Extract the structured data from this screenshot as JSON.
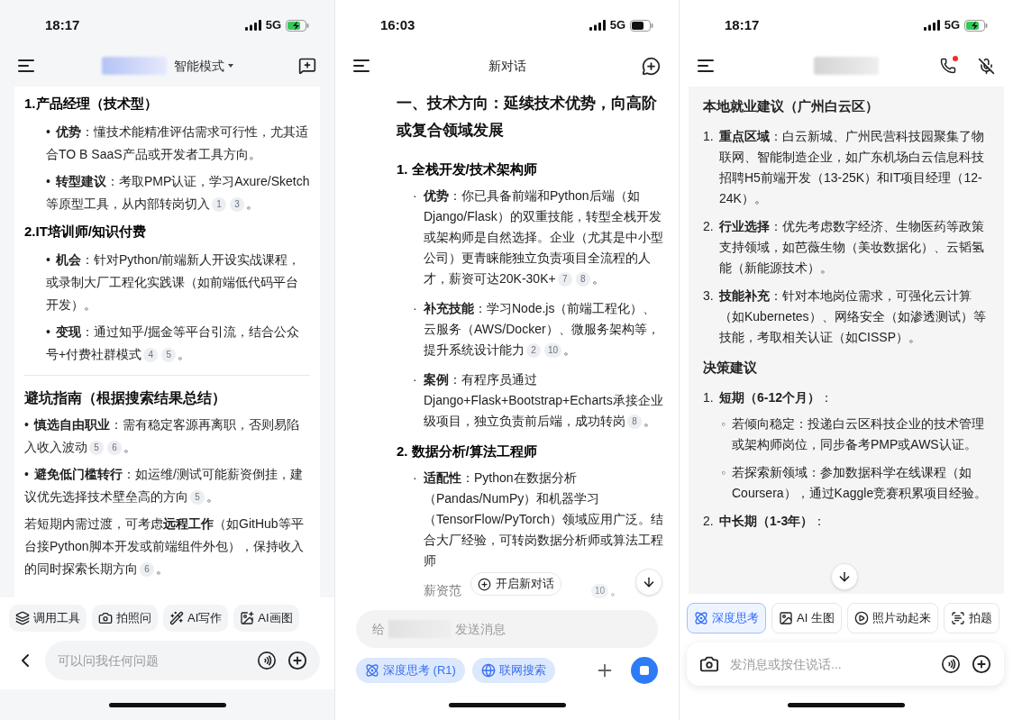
{
  "phones": [
    {
      "status": {
        "time": "18:17",
        "network": "5G",
        "charging": true
      },
      "header": {
        "left": [
          {
            "kind": "menu"
          }
        ],
        "center": [
          {
            "kind": "blur"
          },
          {
            "kind": "mode",
            "text": "智能模式"
          }
        ],
        "right": [
          {
            "kind": "new_chat"
          }
        ]
      },
      "blocks": [
        {
          "kind": "numbered_title",
          "num": "1.",
          "text": "产品经理（技术型）",
          "children": [
            {
              "kind": "bullet",
              "marker": "•",
              "text": "**优势**：懂技术能精准评估需求可行性，尤其适合TO B SaaS产品或开发者工具方向。"
            },
            {
              "kind": "bullet",
              "marker": "•",
              "text": "**转型建议**：考取PMP认证，学习Axure/Sketch等原型工具，从内部转岗切入",
              "refs": [
                "1",
                "3"
              ],
              "end": "。"
            }
          ]
        },
        {
          "kind": "numbered_title",
          "num": "2.",
          "text": "IT培训师/知识付费",
          "children": [
            {
              "kind": "bullet",
              "marker": "•",
              "text": "**机会**：针对Python/前端新人开设实战课程，或录制大厂工程化实践课（如前端低代码平台开发）。"
            },
            {
              "kind": "bullet",
              "marker": "•",
              "text": "**变现**：通过知乎/掘金等平台引流，结合公众号+付费社群模式",
              "refs": [
                "4",
                "5"
              ],
              "end": "。"
            }
          ]
        },
        {
          "kind": "divider"
        },
        {
          "kind": "heading",
          "text": "避坑指南（根据搜索结果总结）"
        },
        {
          "kind": "bullet",
          "marker": "•",
          "text": "**慎选自由职业**：需有稳定客源再离职，否则易陷入收入波动",
          "refs": [
            "5",
            "6"
          ],
          "end": "。"
        },
        {
          "kind": "bullet",
          "marker": "•",
          "text": "**避免低门槛转行**：如运维/测试可能薪资倒挂，建议优先选择技术壁垒高的方向",
          "refs": [
            "5"
          ],
          "end": "。"
        },
        {
          "kind": "para",
          "text": "若短期内需过渡，可考虑**远程工作**（如GitHub等平台接Python脚本开发或前端组件外包），保持收入的同时探索长期方向",
          "refs": [
            "6"
          ],
          "end": "。"
        }
      ],
      "chips": [
        {
          "kind": "tools",
          "label": "调用工具",
          "selected": false
        },
        {
          "kind": "photo_ask",
          "label": "拍照问",
          "selected": false
        },
        {
          "kind": "write",
          "label": "AI写作",
          "selected": false
        },
        {
          "kind": "draw",
          "label": "AI画图",
          "selected": false
        }
      ],
      "nav": [
        {
          "kind": "back"
        }
      ],
      "input": {
        "placeholder": [
          "可以问我任何问题"
        ],
        "trailing": [
          {
            "kind": "voice"
          },
          {
            "kind": "plus"
          }
        ]
      }
    },
    {
      "status": {
        "time": "16:03",
        "network": "5G",
        "charging": false
      },
      "header": {
        "left": [
          {
            "kind": "menu"
          }
        ],
        "center": [
          {
            "kind": "title",
            "text": "新对话"
          }
        ],
        "right": [
          {
            "kind": "add_chat"
          }
        ]
      },
      "blocks": [
        {
          "kind": "h1",
          "text": "一、技术方向：延续技术优势，向高阶或复合领域发展"
        },
        {
          "kind": "numbered_title",
          "num": "1.",
          "text": "全栈开发/技术架构师",
          "children": [
            {
              "kind": "bullet",
              "marker": "·",
              "text": "**优势**：你已具备前端和Python后端（如Django/Flask）的双重技能，转型全栈开发或架构师是自然选择。企业（尤其是中小型公司）更青睐能独立负责项目全流程的人才，薪资可达20K-30K+",
              "refs": [
                "7",
                "8"
              ],
              "end": "。"
            },
            {
              "kind": "bullet",
              "marker": "·",
              "text": "**补充技能**：学习Node.js（前端工程化）、云服务（AWS/Docker）、微服务架构等，提升系统设计能力",
              "refs": [
                "2",
                "10"
              ],
              "end": "。"
            },
            {
              "kind": "bullet",
              "marker": "·",
              "text": "**案例**：有程序员通过Django+Flask+Bootstrap+Echarts承接企业级项目，独立负责前后端，成功转岗",
              "refs": [
                "8"
              ],
              "end": "。"
            }
          ]
        },
        {
          "kind": "numbered_title",
          "num": "2.",
          "text": "数据分析/算法工程师",
          "children": [
            {
              "kind": "bullet",
              "marker": "·",
              "text": "**适配性**：Python在数据分析（Pandas/NumPy）和机器学习（TensorFlow/PyTorch）领域应用广泛。结合大厂经验，可转岗数据分析师或算法工程师"
            },
            {
              "kind": "tail",
              "text": "薪资范",
              "refs": [
                "10"
              ],
              "end": "。"
            }
          ]
        }
      ],
      "overlays": [
        {
          "kind": "new_chat_pill",
          "text": "开启新对话"
        },
        {
          "kind": "scroll_down"
        }
      ],
      "chips": [
        {
          "kind": "think",
          "label": "深度思考 (R1)",
          "selected": true
        },
        {
          "kind": "web",
          "label": "联网搜索",
          "selected": true
        }
      ],
      "input": {
        "placeholder": [
          "给",
          "发送消息"
        ]
      },
      "actions": [
        {
          "kind": "add"
        },
        {
          "kind": "stop"
        }
      ]
    },
    {
      "status": {
        "time": "18:17",
        "network": "5G",
        "charging": true
      },
      "header": {
        "left": [
          {
            "kind": "menu"
          }
        ],
        "center": [
          {
            "kind": "blur"
          }
        ],
        "right": [
          {
            "kind": "call",
            "badge": true
          },
          {
            "kind": "mute"
          }
        ]
      },
      "blocks": [
        {
          "kind": "heading",
          "text": "本地就业建议（广州白云区）"
        },
        {
          "kind": "numbered",
          "num": "1.",
          "text": "**重点区域**：白云新城、广州民营科技园聚集了物联网、智能制造企业，如广东机场白云信息科技招聘H5前端开发（13-25K）和IT项目经理（12-24K）。"
        },
        {
          "kind": "numbered",
          "num": "2.",
          "text": "**行业选择**：优先考虑数字经济、生物医药等政策支持领域，如芭薇生物（美妆数据化）、云韬氢能（新能源技术）。"
        },
        {
          "kind": "numbered",
          "num": "3.",
          "text": "**技能补充**：针对本地岗位需求，可强化云计算（如Kubernetes）、网络安全（如渗透测试）等技能，考取相关认证（如CISSP）。"
        },
        {
          "kind": "heading",
          "text": "决策建议"
        },
        {
          "kind": "numbered",
          "num": "1.",
          "text": "**短期（6-12个月）**：",
          "children": [
            {
              "kind": "bullet",
              "marker": "◦",
              "text": "若倾向稳定：投递白云区科技企业的技术管理或架构师岗位，同步备考PMP或AWS认证。"
            },
            {
              "kind": "bullet",
              "marker": "◦",
              "text": "若探索新领域：参加数据科学在线课程（如Coursera），通过Kaggle竞赛积累项目经验。"
            }
          ]
        },
        {
          "kind": "numbered",
          "num": "2.",
          "text": "**中长期（1-3年）**："
        }
      ],
      "overlays": [
        {
          "kind": "scroll_down"
        }
      ],
      "chips": [
        {
          "kind": "think",
          "label": "深度思考",
          "selected": true
        },
        {
          "kind": "image",
          "label": "AI 生图",
          "selected": false
        },
        {
          "kind": "video",
          "label": "照片动起来",
          "selected": false
        },
        {
          "kind": "scan",
          "label": "拍题",
          "selected": false
        }
      ],
      "input": {
        "placeholder": [
          "发消息或按住说话..."
        ],
        "leading": [
          {
            "kind": "camera"
          }
        ],
        "trailing": [
          {
            "kind": "voice"
          },
          {
            "kind": "plus"
          }
        ]
      }
    }
  ]
}
